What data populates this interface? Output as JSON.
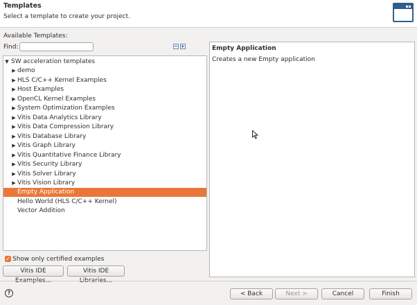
{
  "header": {
    "title": "Templates",
    "subtitle": "Select a template to create your project."
  },
  "available_label": "Available Templates:",
  "find": {
    "label": "Find:",
    "value": "",
    "placeholder": ""
  },
  "tree": {
    "root": "SW acceleration templates",
    "items": [
      {
        "label": "demo",
        "expandable": true
      },
      {
        "label": "HLS C/C++ Kernel Examples",
        "expandable": true
      },
      {
        "label": "Host Examples",
        "expandable": true
      },
      {
        "label": "OpenCL Kernel Examples",
        "expandable": true
      },
      {
        "label": "System Optimization Examples",
        "expandable": true
      },
      {
        "label": "Vitis Data Analytics Library",
        "expandable": true
      },
      {
        "label": "Vitis Data Compression Library",
        "expandable": true
      },
      {
        "label": "Vitis Database Library",
        "expandable": true
      },
      {
        "label": "Vitis Graph Library",
        "expandable": true
      },
      {
        "label": "Vitis Quantitative Finance Library",
        "expandable": true
      },
      {
        "label": "Vitis Security Library",
        "expandable": true
      },
      {
        "label": "Vitis Solver Library",
        "expandable": true
      },
      {
        "label": "Vitis Vision Library",
        "expandable": true
      },
      {
        "label": "Empty Application",
        "expandable": false,
        "selected": true
      },
      {
        "label": "Hello World (HLS C/C++ Kernel)",
        "expandable": false
      },
      {
        "label": "Vector Addition",
        "expandable": false
      }
    ]
  },
  "certified": {
    "label": "Show only certified examples",
    "checked": true
  },
  "buttons": {
    "ide_examples": "Vitis IDE Examples...",
    "ide_libraries": "Vitis IDE Libraries...",
    "back": "< Back",
    "next": "Next >",
    "cancel": "Cancel",
    "finish": "Finish"
  },
  "description": {
    "title": "Empty Application",
    "text": "Creates a new Empty application"
  },
  "colors": {
    "accent": "#e97838",
    "icon_blue": "#2f5f8c"
  },
  "icons": [
    "window-icon",
    "collapse-all-icon",
    "expand-all-icon",
    "help-icon"
  ]
}
